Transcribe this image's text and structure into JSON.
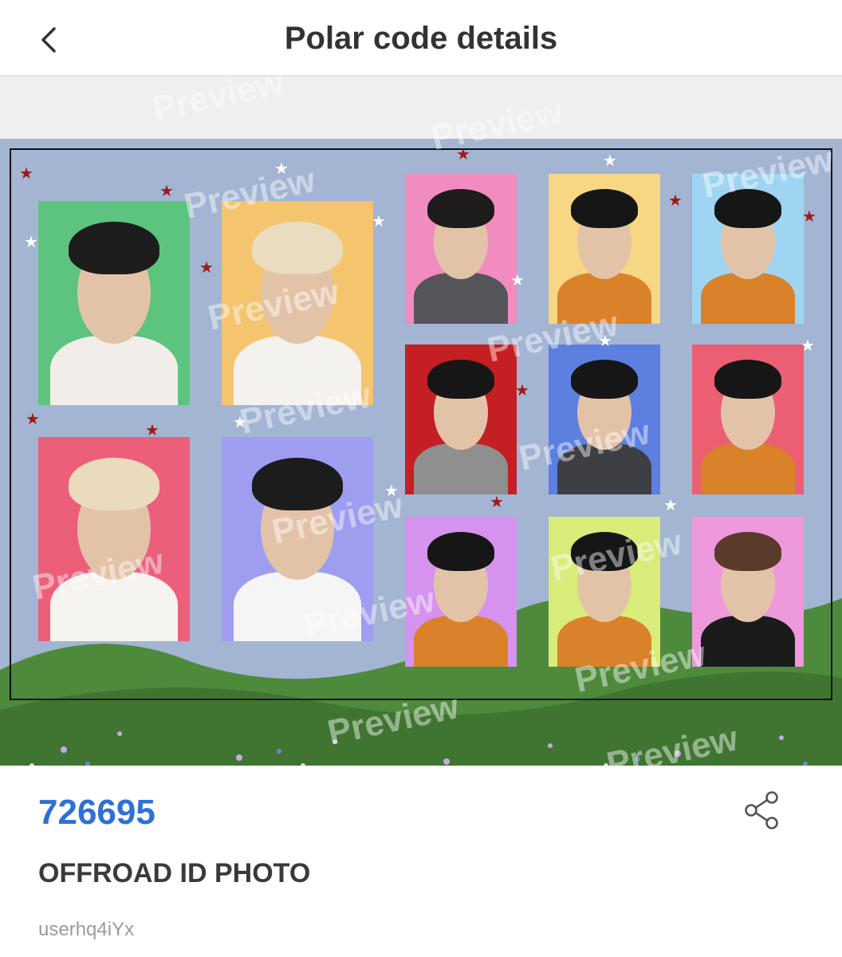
{
  "header": {
    "title": "Polar code details",
    "back_icon": "chevron-left-icon"
  },
  "preview": {
    "watermark": "Preview",
    "photos": [
      {
        "bg": "#5cc47e",
        "hair": "#1c1c1c",
        "top": "#f1eee9"
      },
      {
        "bg": "#f5c46e",
        "hair": "#e9dcc0",
        "top": "#f4f2ee"
      },
      {
        "bg": "#ec5f7a",
        "hair": "#eadbbd",
        "top": "#f5f3ef"
      },
      {
        "bg": "#9e9df0",
        "hair": "#1c1c1c",
        "top": "#f5f5f5"
      },
      {
        "bg": "#f08cc0",
        "hair": "#1e1b1b",
        "top": "#55555a"
      },
      {
        "bg": "#f7d784",
        "hair": "#161616",
        "top": "#d9822a"
      },
      {
        "bg": "#9fd5f2",
        "hair": "#161616",
        "top": "#d9822a"
      },
      {
        "bg": "#c41f22",
        "hair": "#161616",
        "top": "#8f8f8f"
      },
      {
        "bg": "#5c7fe0",
        "hair": "#161616",
        "top": "#3e3f44"
      },
      {
        "bg": "#ec5f72",
        "hair": "#161616",
        "top": "#d9822a"
      },
      {
        "bg": "#d593ef",
        "hair": "#161616",
        "top": "#d9822a"
      },
      {
        "bg": "#d8ec7a",
        "hair": "#161616",
        "top": "#d9822a"
      },
      {
        "bg": "#ee99dc",
        "hair": "#5a3a2a",
        "top": "#1b1b1b"
      }
    ]
  },
  "info": {
    "code": "726695",
    "name": "OFFROAD ID PHOTO",
    "user": "userhq4iYx",
    "share_icon": "share-icon"
  },
  "colors": {
    "accent": "#2f6fd8",
    "card_bg": "#a3b5d3",
    "star_red": "#9c1b1b"
  }
}
